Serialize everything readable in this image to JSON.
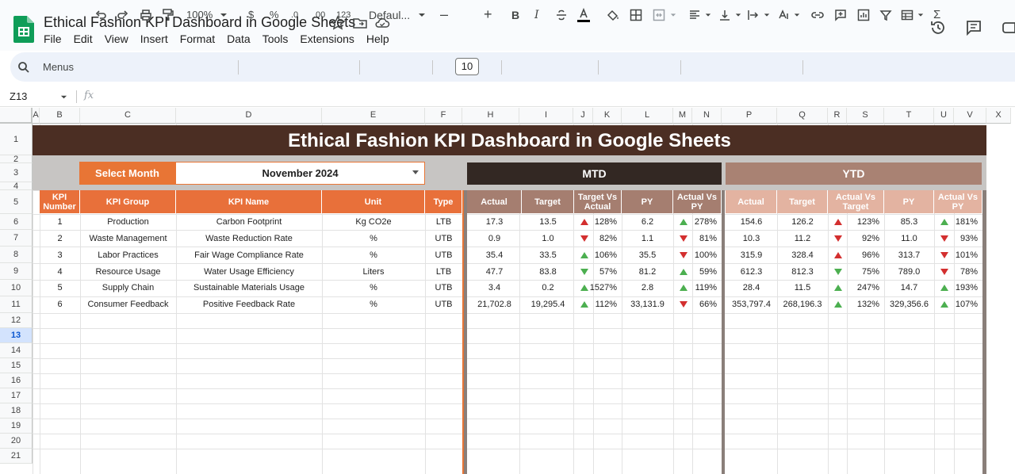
{
  "document": {
    "title": "Ethical Fashion KPI Dashboard in Google Sheets",
    "menu": [
      "File",
      "Edit",
      "View",
      "Insert",
      "Format",
      "Data",
      "Tools",
      "Extensions",
      "Help"
    ]
  },
  "toolbar": {
    "search_label": "Menus",
    "zoom": "100%",
    "currency": "$",
    "percent": "%",
    "decrease_decimal": ".0",
    "increase_decimal": ".00",
    "number_format": "123",
    "font": "Defaul...",
    "font_size": "10",
    "bold": "B",
    "function": "Σ"
  },
  "formula_bar": {
    "cell_ref": "Z13",
    "fx": "fx"
  },
  "columns": [
    "A",
    "B",
    "C",
    "D",
    "E",
    "F",
    "H",
    "I",
    "J",
    "K",
    "L",
    "M",
    "N",
    "P",
    "Q",
    "R",
    "S",
    "T",
    "U",
    "V",
    "X"
  ],
  "rows": [
    "1",
    "2",
    "3",
    "4",
    "5",
    "6",
    "7",
    "8",
    "9",
    "10",
    "11",
    "12",
    "13",
    "14",
    "15",
    "16",
    "17",
    "18",
    "19",
    "20",
    "21"
  ],
  "selected_row": "13",
  "dashboard": {
    "title": "Ethical Fashion KPI Dashboard in Google Sheets",
    "select_month_label": "Select Month",
    "selected_month": "November 2024",
    "mtd_label": "MTD",
    "ytd_label": "YTD",
    "headers": {
      "kpi_number": "KPI Number",
      "kpi_group": "KPI Group",
      "kpi_name": "KPI Name",
      "unit": "Unit",
      "type": "Type",
      "actual": "Actual",
      "target": "Target",
      "target_vs_actual": "Target Vs Actual",
      "py": "PY",
      "actual_vs_py": "Actual Vs PY",
      "actual_vs_target": "Actual Vs Target"
    },
    "rows": [
      {
        "num": "1",
        "group": "Production",
        "name": "Carbon Footprint",
        "unit": "Kg CO2e",
        "type": "LTB",
        "mtd_actual": "17.3",
        "mtd_target": "13.5",
        "mtd_tva": "128%",
        "mtd_tva_dir": "up-red",
        "mtd_py": "6.2",
        "mtd_avp": "278%",
        "mtd_avp_dir": "up-green",
        "ytd_actual": "154.6",
        "ytd_target": "126.2",
        "ytd_avt": "123%",
        "ytd_avt_dir": "up-red",
        "ytd_py": "85.3",
        "ytd_avp": "181%",
        "ytd_avp_dir": "up-green"
      },
      {
        "num": "2",
        "group": "Waste Management",
        "name": "Waste Reduction Rate",
        "unit": "%",
        "type": "UTB",
        "mtd_actual": "0.9",
        "mtd_target": "1.0",
        "mtd_tva": "82%",
        "mtd_tva_dir": "down-red",
        "mtd_py": "1.1",
        "mtd_avp": "81%",
        "mtd_avp_dir": "down-red",
        "ytd_actual": "10.3",
        "ytd_target": "11.2",
        "ytd_avt": "92%",
        "ytd_avt_dir": "down-red",
        "ytd_py": "11.0",
        "ytd_avp": "93%",
        "ytd_avp_dir": "down-red"
      },
      {
        "num": "3",
        "group": "Labor Practices",
        "name": "Fair Wage Compliance Rate",
        "unit": "%",
        "type": "UTB",
        "mtd_actual": "35.4",
        "mtd_target": "33.5",
        "mtd_tva": "106%",
        "mtd_tva_dir": "up-green",
        "mtd_py": "35.5",
        "mtd_avp": "100%",
        "mtd_avp_dir": "down-red",
        "ytd_actual": "315.9",
        "ytd_target": "328.4",
        "ytd_avt": "96%",
        "ytd_avt_dir": "up-red",
        "ytd_py": "313.7",
        "ytd_avp": "101%",
        "ytd_avp_dir": "down-red"
      },
      {
        "num": "4",
        "group": "Resource Usage",
        "name": "Water Usage Efficiency",
        "unit": "Liters",
        "type": "LTB",
        "mtd_actual": "47.7",
        "mtd_target": "83.8",
        "mtd_tva": "57%",
        "mtd_tva_dir": "down-green",
        "mtd_py": "81.2",
        "mtd_avp": "59%",
        "mtd_avp_dir": "up-green",
        "ytd_actual": "612.3",
        "ytd_target": "812.3",
        "ytd_avt": "75%",
        "ytd_avt_dir": "down-green",
        "ytd_py": "789.0",
        "ytd_avp": "78%",
        "ytd_avp_dir": "down-red"
      },
      {
        "num": "5",
        "group": "Supply Chain",
        "name": "Sustainable Materials Usage",
        "unit": "%",
        "type": "UTB",
        "mtd_actual": "3.4",
        "mtd_target": "0.2",
        "mtd_tva": "1527%",
        "mtd_tva_dir": "up-green",
        "mtd_py": "2.8",
        "mtd_avp": "119%",
        "mtd_avp_dir": "up-green",
        "ytd_actual": "28.4",
        "ytd_target": "11.5",
        "ytd_avt": "247%",
        "ytd_avt_dir": "up-green",
        "ytd_py": "14.7",
        "ytd_avp": "193%",
        "ytd_avp_dir": "up-green"
      },
      {
        "num": "6",
        "group": "Consumer Feedback",
        "name": "Positive Feedback Rate",
        "unit": "%",
        "type": "UTB",
        "mtd_actual": "21,702.8",
        "mtd_target": "19,295.4",
        "mtd_tva": "112%",
        "mtd_tva_dir": "up-green",
        "mtd_py": "33,131.9",
        "mtd_avp": "66%",
        "mtd_avp_dir": "down-red",
        "ytd_actual": "353,797.4",
        "ytd_target": "268,196.3",
        "ytd_avt": "132%",
        "ytd_avt_dir": "up-green",
        "ytd_py": "329,356.6",
        "ytd_avp": "107%",
        "ytd_avp_dir": "up-green"
      }
    ]
  }
}
